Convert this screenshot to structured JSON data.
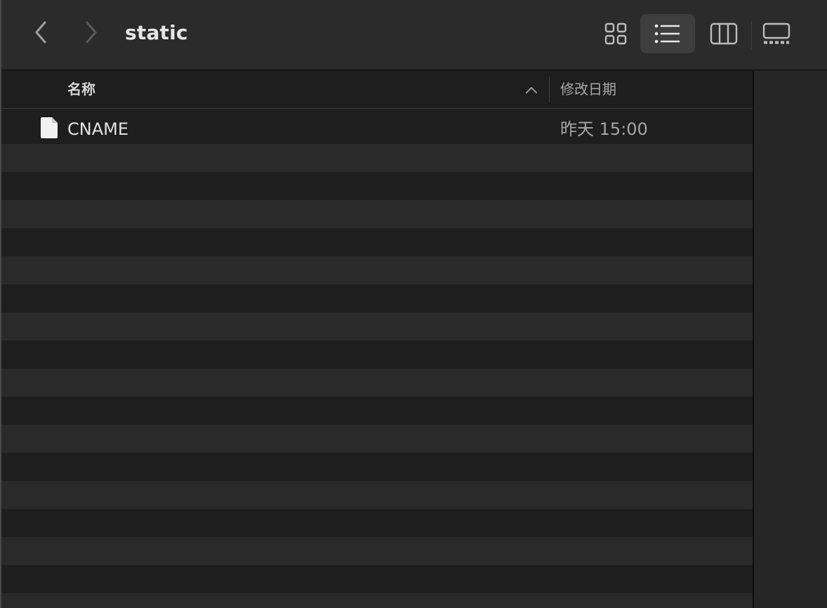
{
  "window": {
    "title": "static"
  },
  "toolbar": {
    "back_icon": "chevron-left-icon",
    "forward_icon": "chevron-right-icon",
    "views": [
      {
        "name": "icon-view",
        "icon": "grid-icon",
        "selected": false
      },
      {
        "name": "list-view",
        "icon": "list-icon",
        "selected": true
      },
      {
        "name": "column-view",
        "icon": "columns-icon",
        "selected": false
      },
      {
        "name": "gallery-view",
        "icon": "gallery-icon",
        "selected": false
      }
    ]
  },
  "list": {
    "columns": {
      "name": "名称",
      "date": "修改日期"
    },
    "sort": {
      "column": "name",
      "direction": "ascending",
      "icon": "chevron-up-icon"
    },
    "files": [
      {
        "name": "CNAME",
        "modified": "昨天 15:00",
        "icon": "document-icon"
      }
    ]
  },
  "colors": {
    "toolbar_bg": "#2b2b2b",
    "list_bg": "#1e1e1e",
    "row_alt_bg": "#2a2a2a",
    "selected_view_bg": "#3e3e3e"
  }
}
